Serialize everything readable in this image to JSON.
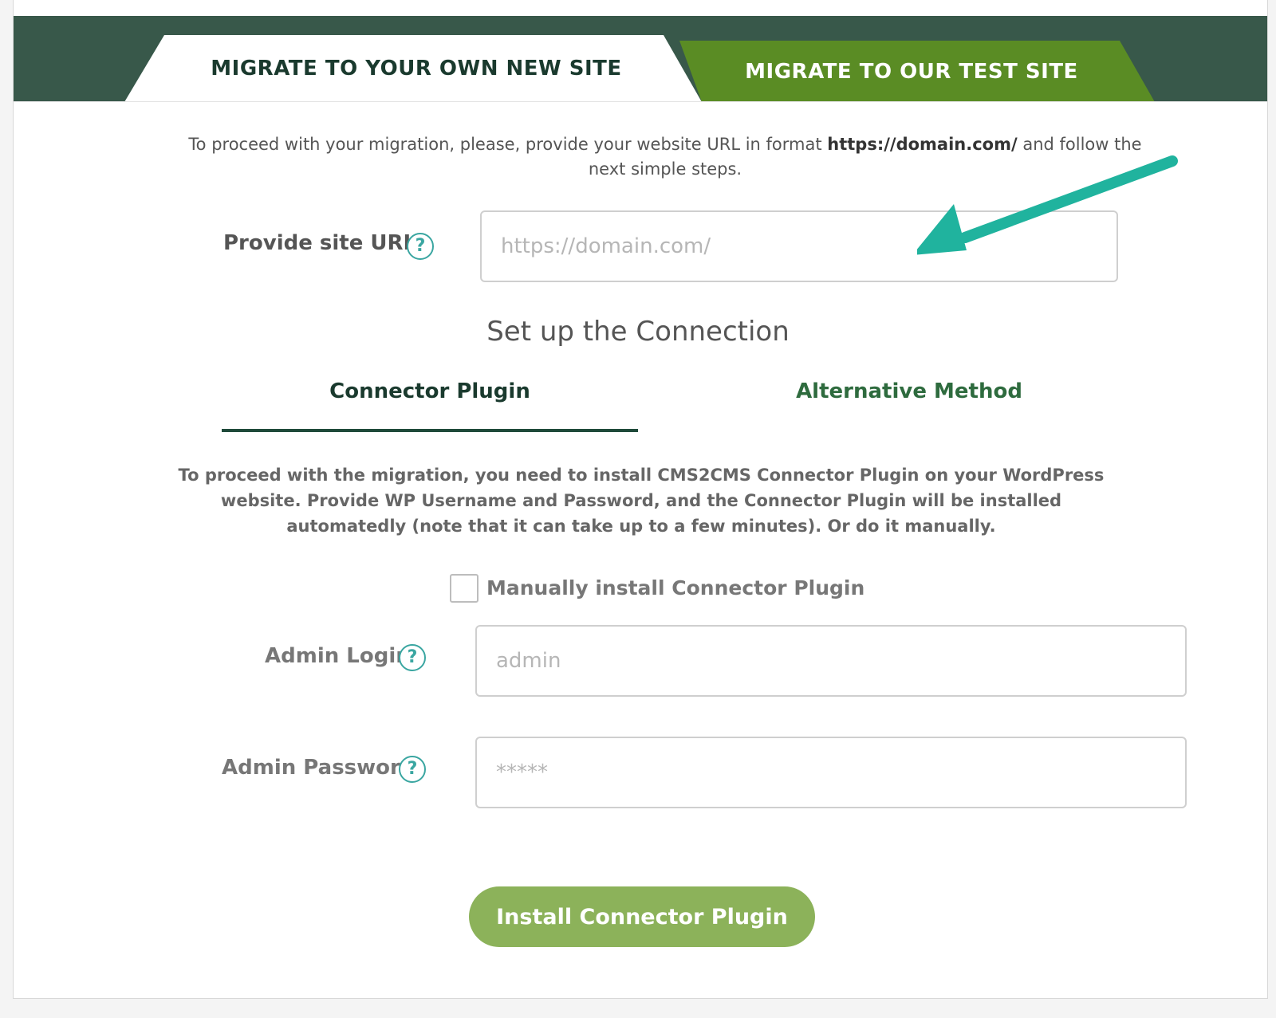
{
  "tabs": {
    "own_site": "MIGRATE TO YOUR OWN NEW SITE",
    "test_site": "MIGRATE TO OUR TEST SITE"
  },
  "intro": {
    "before": "To proceed with your migration, please, provide your website URL in format ",
    "url_format": "https://domain.com/",
    "after": " and follow the next simple steps."
  },
  "site_url": {
    "label": "Provide site URL",
    "placeholder": "https://domain.com/",
    "help": "?"
  },
  "connection": {
    "title": "Set up the Connection",
    "tab_plugin": "Connector Plugin",
    "tab_alternative": "Alternative Method",
    "description": "To proceed with the migration, you need to install CMS2CMS Connector Plugin on your WordPress website. Provide WP Username and Password, and the Connector Plugin will be installed automatedly (note that it can take up to a few minutes). Or do it manually."
  },
  "manual_install": {
    "label": "Manually install Connector Plugin",
    "checked": false
  },
  "admin_login": {
    "label": "Admin Login",
    "placeholder": "admin",
    "help": "?"
  },
  "admin_password": {
    "label": "Admin Password",
    "placeholder": "*****",
    "help": "?"
  },
  "install_button": "Install Connector Plugin",
  "colors": {
    "header_band": "#38584a",
    "test_tab": "#5a8c24",
    "accent_teal": "#3aa6a1",
    "button": "#8cb25a",
    "arrow": "#20b39e"
  },
  "icons": {
    "help": "help-circle-icon",
    "annotation": "arrow-pointer-icon"
  }
}
